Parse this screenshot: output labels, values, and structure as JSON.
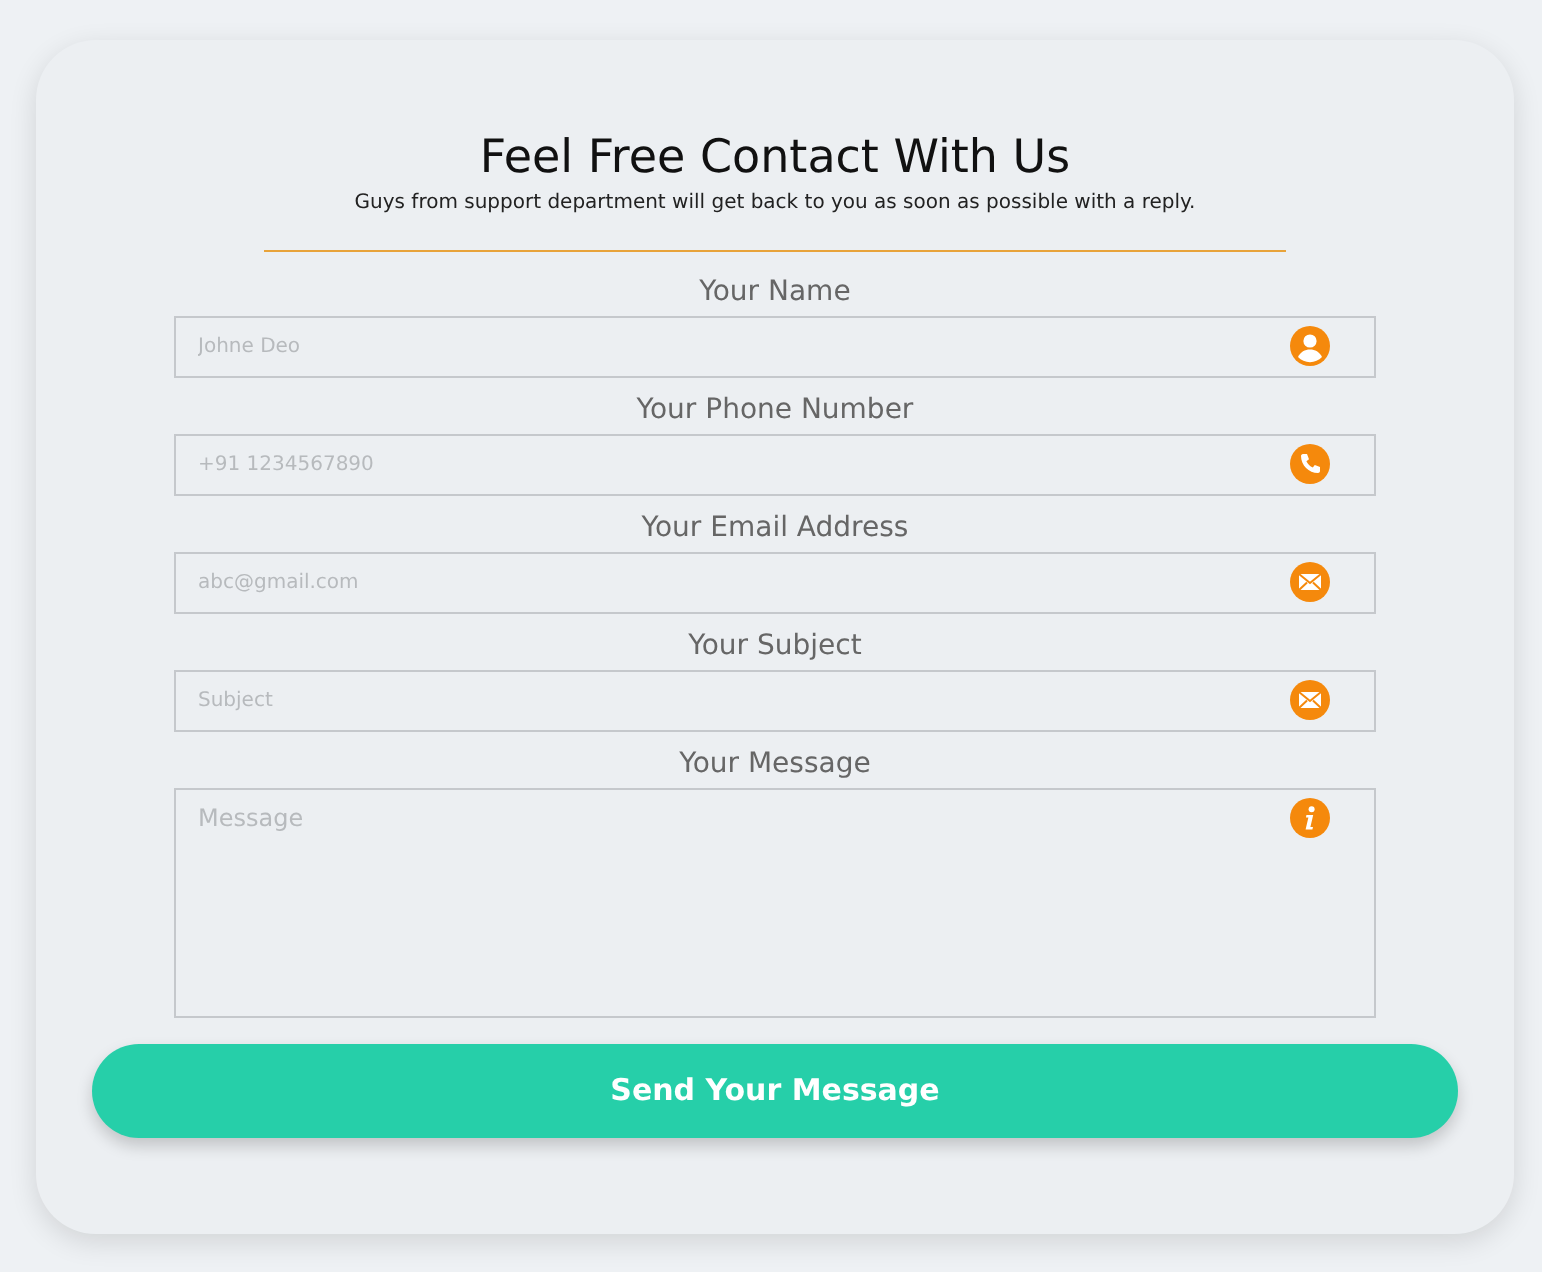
{
  "title": "Feel Free Contact With Us",
  "subtitle": "Guys from support department will get back to you as soon as possible with a reply.",
  "fields": [
    {
      "kind": "name",
      "label": "Your Name",
      "placeholder": "Johne Deo"
    },
    {
      "kind": "phone",
      "label": "Your Phone Number",
      "placeholder": "+91 1234567890"
    },
    {
      "kind": "email",
      "label": "Your Email Address",
      "placeholder": "abc@gmail.com"
    },
    {
      "kind": "subject",
      "label": "Your Subject",
      "placeholder": "Subject"
    },
    {
      "kind": "message",
      "label": "Your Message",
      "placeholder": "Message"
    }
  ],
  "submit": "Send Your Message"
}
